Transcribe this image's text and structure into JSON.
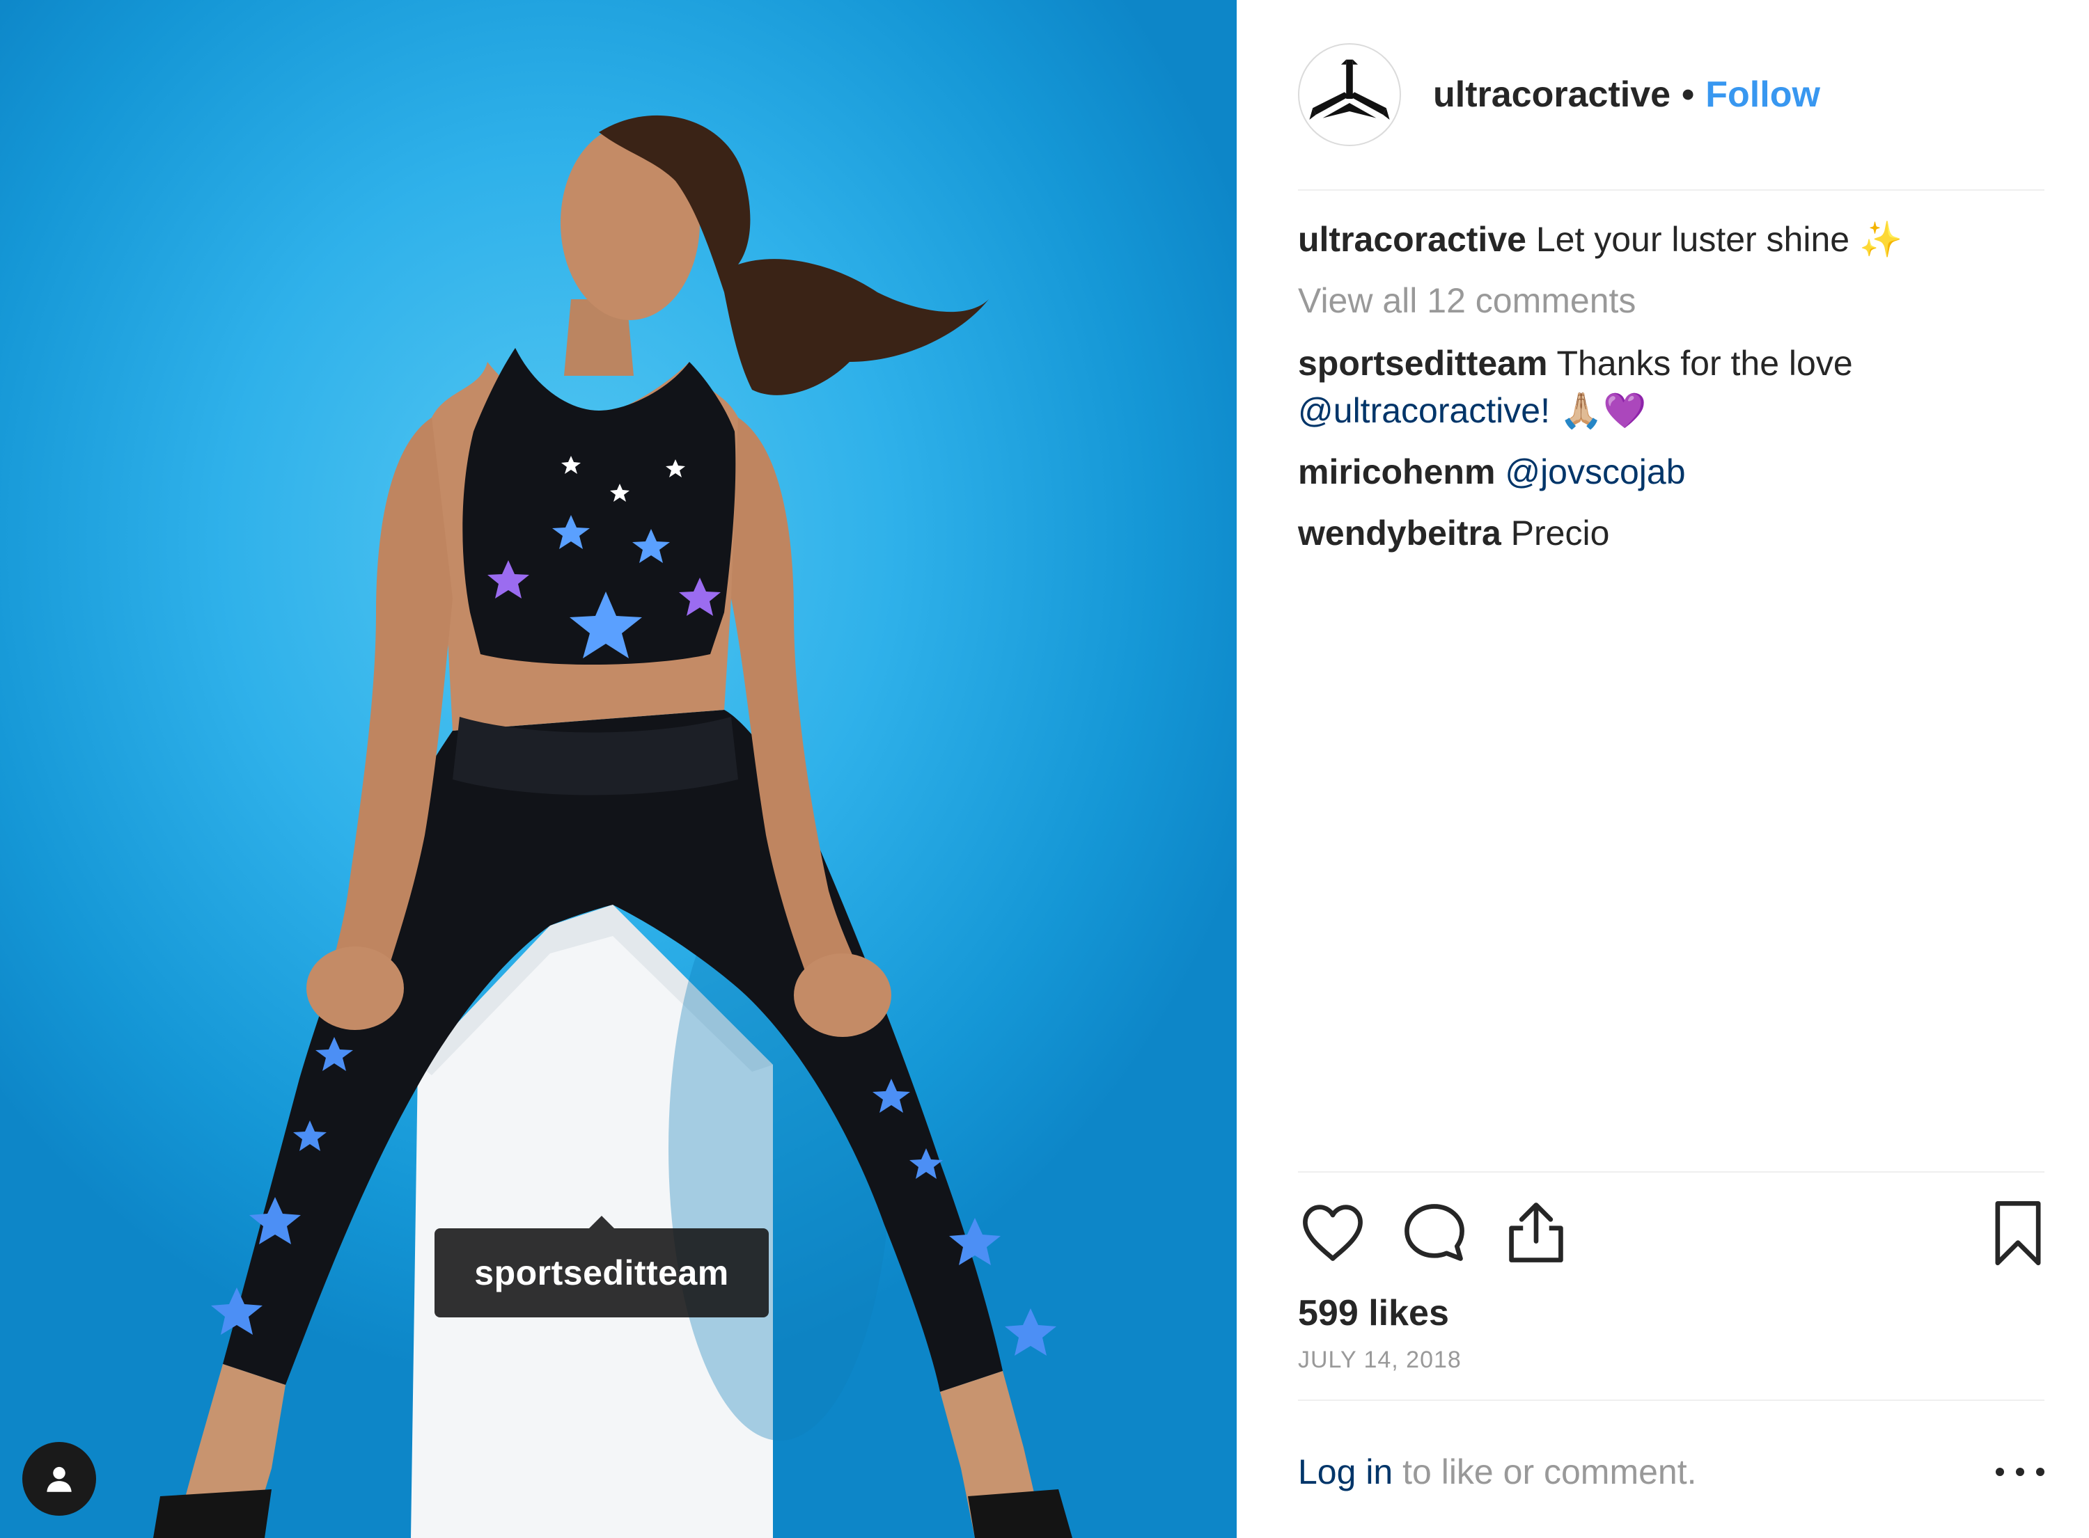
{
  "post": {
    "photo_alt": "",
    "tag_label": "sportseditteam"
  },
  "header": {
    "username": "ultracoractive",
    "separator": "•",
    "follow_label": "Follow"
  },
  "caption": {
    "username": "ultracoractive",
    "text": "Let your luster shine ",
    "emoji": "✨"
  },
  "view_all_label": "View all 12 comments",
  "comments": [
    {
      "username": "sportseditteam",
      "text": "Thanks for the love",
      "mention": "@ultracoractive!",
      "emoji": "🙏🏼💜"
    },
    {
      "username": "miricohenm",
      "mention": "@jovscojab"
    },
    {
      "username": "wendybeitra",
      "text": "Precio"
    }
  ],
  "stats": {
    "likes": "599 likes",
    "date": "JULY 14, 2018"
  },
  "login": {
    "link": "Log in",
    "rest": " to like or comment."
  },
  "icons": [
    "heart-icon",
    "comment-icon",
    "share-icon",
    "bookmark-icon",
    "more-options-icon",
    "user-tag-icon"
  ],
  "colors": {
    "link_blue": "#3897f0",
    "mention_blue": "#003569",
    "muted": "#999999",
    "text": "#262626",
    "photo_background": "#2fb1ea"
  }
}
